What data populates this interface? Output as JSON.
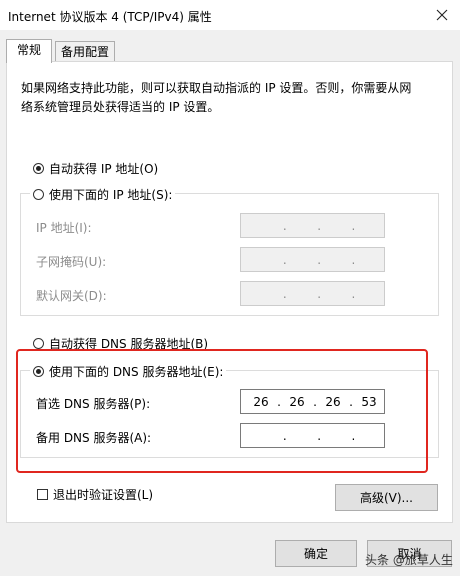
{
  "window": {
    "title": "Internet 协议版本 4 (TCP/IPv4) 属性",
    "close_icon": "close-icon"
  },
  "tabs": [
    {
      "label": "常规",
      "active": true
    },
    {
      "label": "备用配置",
      "active": false
    }
  ],
  "description": {
    "line1": "如果网络支持此功能，则可以获取自动指派的 IP 设置。否则，你需要从网",
    "line2": "络系统管理员处获得适当的 IP 设置。"
  },
  "ip_section": {
    "auto_label": "自动获得 IP 地址(O)",
    "auto_checked": true,
    "manual_label": "使用下面的 IP 地址(S):",
    "manual_checked": false,
    "fields": [
      {
        "label": "IP 地址(I):",
        "octets": [
          "",
          "",
          "",
          ""
        ],
        "disabled": true
      },
      {
        "label": "子网掩码(U):",
        "octets": [
          "",
          "",
          "",
          ""
        ],
        "disabled": true
      },
      {
        "label": "默认网关(D):",
        "octets": [
          "",
          "",
          "",
          ""
        ],
        "disabled": true
      }
    ]
  },
  "dns_section": {
    "auto_label": "自动获得 DNS 服务器地址(B)",
    "auto_checked": false,
    "manual_label": "使用下面的 DNS 服务器地址(E):",
    "manual_checked": true,
    "preferred": {
      "label": "首选 DNS 服务器(P):",
      "octets": [
        "26",
        "26",
        "26",
        "53"
      ]
    },
    "alternate": {
      "label": "备用 DNS 服务器(A):",
      "octets": [
        "",
        "",
        "",
        ""
      ]
    }
  },
  "validate": {
    "label": "退出时验证设置(L)",
    "checked": false
  },
  "buttons": {
    "advanced": "高级(V)...",
    "ok": "确定",
    "cancel": "取消"
  },
  "watermark": "头条 @旅草人生",
  "highlight_color": "#e0261f"
}
